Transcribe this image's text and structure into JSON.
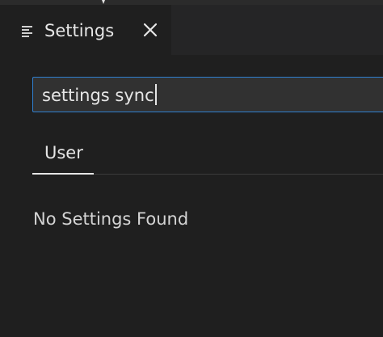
{
  "editor": {
    "tab": {
      "label": "Settings",
      "icon": "settings-editor-icon",
      "close_icon": "close-icon"
    }
  },
  "settings": {
    "search": {
      "value": "settings sync"
    },
    "scope_tabs": [
      {
        "label": "User",
        "active": true
      }
    ],
    "empty_message": "No Settings Found"
  },
  "colors": {
    "background": "#1f1f1f",
    "tab_bar": "#252526",
    "focus_border": "#2f7fcf",
    "text": "#e6e6e6"
  }
}
